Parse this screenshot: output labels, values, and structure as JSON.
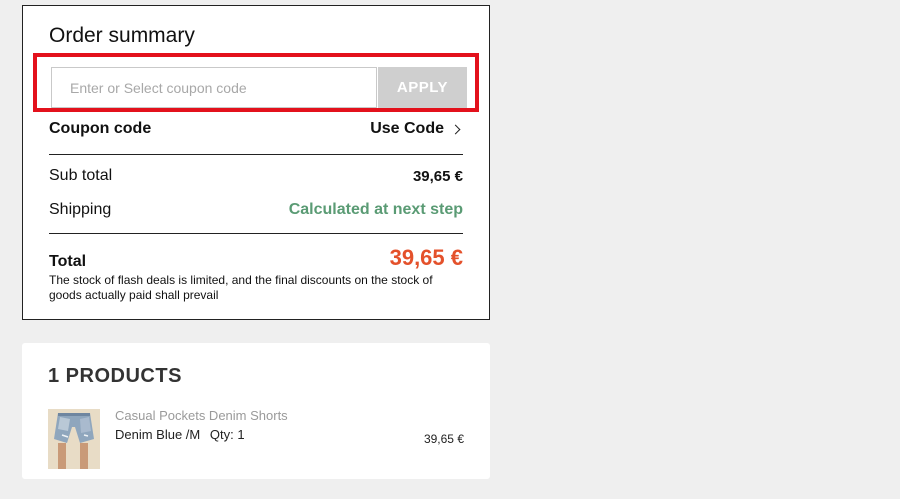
{
  "summary": {
    "title": "Order summary",
    "coupon_placeholder": "Enter or Select coupon code",
    "coupon_value": "",
    "apply_label": "APPLY",
    "coupon_label": "Coupon code",
    "use_code_label": "Use Code",
    "subtotal_label": "Sub total",
    "subtotal_value": "39,65 €",
    "shipping_label": "Shipping",
    "shipping_value": "Calculated at next step",
    "total_label": "Total",
    "total_value": "39,65 €",
    "note": "The stock of flash deals is limited, and the final discounts on the stock of goods actually paid shall prevail"
  },
  "products": {
    "title": "1 PRODUCTS",
    "items": [
      {
        "name": "Casual Pockets Denim Shorts",
        "variant": "Denim Blue /M",
        "qty": "Qty: 1",
        "price": "39,65 €",
        "image_icon": "denim-shorts-product-image"
      }
    ]
  },
  "colors": {
    "highlight_border": "#e3111c",
    "total_price": "#e4512b",
    "shipping_text": "#5a9b74",
    "apply_button_bg": "#cfcfcf"
  }
}
